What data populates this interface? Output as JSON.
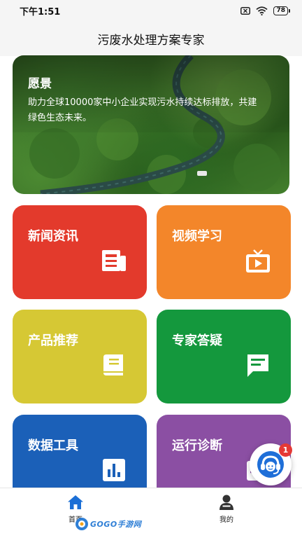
{
  "status_bar": {
    "time": "下午1:51",
    "battery": "78"
  },
  "header": {
    "title": "污废水处理方案专家"
  },
  "banner": {
    "title": "愿景",
    "text": "助力全球10000家中小企业实现污水持续达标排放，共建绿色生态未来。"
  },
  "tiles": [
    {
      "label": "新闻资讯",
      "color": "#e33a2c",
      "icon": "newspaper-icon"
    },
    {
      "label": "视频学习",
      "color": "#f3862a",
      "icon": "tv-icon"
    },
    {
      "label": "产品推荐",
      "color": "#d6c834",
      "icon": "book-icon"
    },
    {
      "label": "专家答疑",
      "color": "#14983d",
      "icon": "chat-bubble-icon"
    },
    {
      "label": "数据工具",
      "color": "#1b60b8",
      "icon": "bar-chart-icon"
    },
    {
      "label": "运行诊断",
      "color": "#8b4fa3",
      "icon": "diagnosis-icon"
    }
  ],
  "floating_support": {
    "badge_count": "1",
    "icon": "customer-service-icon"
  },
  "tab_bar": {
    "items": [
      {
        "label": "首页",
        "icon": "home-icon",
        "active": true,
        "active_color": "#1b6fd6"
      },
      {
        "label": "我的",
        "icon": "user-icon",
        "active": false
      }
    ]
  },
  "watermark": {
    "text": "GOGO手游网"
  }
}
